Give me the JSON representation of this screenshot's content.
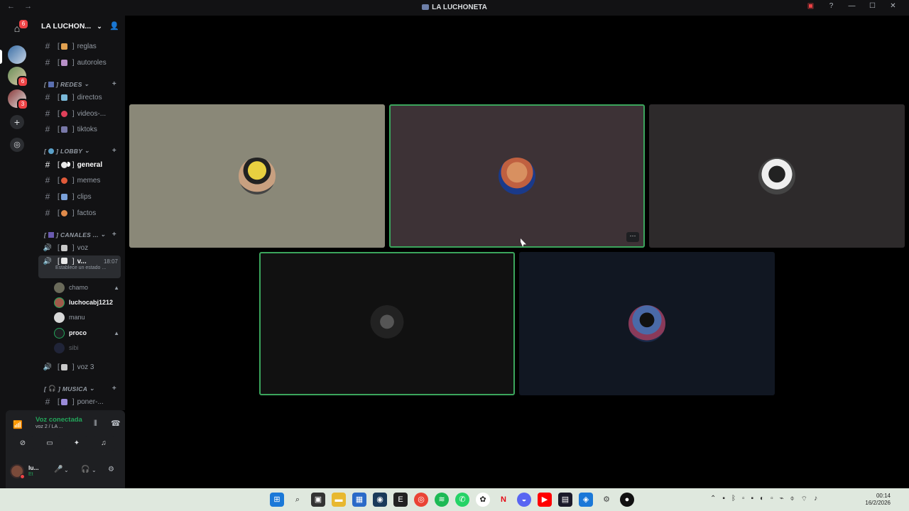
{
  "window": {
    "title": "LA LUCHONETA",
    "nav_back": "←",
    "nav_forward": "→"
  },
  "server": {
    "name": "LA LUCHON...",
    "badges": [
      "6",
      "6",
      "3"
    ]
  },
  "channels": {
    "top": [
      {
        "label": "reglas"
      },
      {
        "label": "autoroles"
      }
    ],
    "categories": {
      "redes": "REDES",
      "lobby": "LOBBY",
      "canales": "CANALES ...",
      "musica": "MUSICA"
    },
    "redes": [
      {
        "label": "directos"
      },
      {
        "label": "videos-..."
      },
      {
        "label": "tiktoks"
      }
    ],
    "lobby": [
      {
        "label": "general"
      },
      {
        "label": "memes"
      },
      {
        "label": "clips"
      },
      {
        "label": "factos"
      }
    ],
    "voice": {
      "voz": "voz",
      "connected_name": "v...",
      "connected_time": "18:07",
      "connected_status": "Establece un estado ...",
      "voz3": "voz 3"
    },
    "voice_users": [
      {
        "name": "chamo"
      },
      {
        "name": "luchocabj1212"
      },
      {
        "name": "manu"
      },
      {
        "name": "proco"
      },
      {
        "name": "sibi"
      }
    ],
    "musica": [
      {
        "label": "poner-..."
      }
    ]
  },
  "voice_panel": {
    "status": "Voz conectada",
    "location": "voz 2 / LA ..."
  },
  "user": {
    "name": "lu...",
    "sub": "Et"
  },
  "tiles": [
    {
      "user": "chamo",
      "bg": "#8a8878"
    },
    {
      "user": "luchocabj1212",
      "bg": "#3d3236",
      "speaking": true
    },
    {
      "user": "manu",
      "bg": "#2d2a2b"
    },
    {
      "user": "proco",
      "bg": "#111111",
      "speaking": true
    },
    {
      "user": "sibi",
      "bg": "#111722"
    }
  ],
  "clock": {
    "time": "00:14",
    "date": "16/2/2026"
  }
}
